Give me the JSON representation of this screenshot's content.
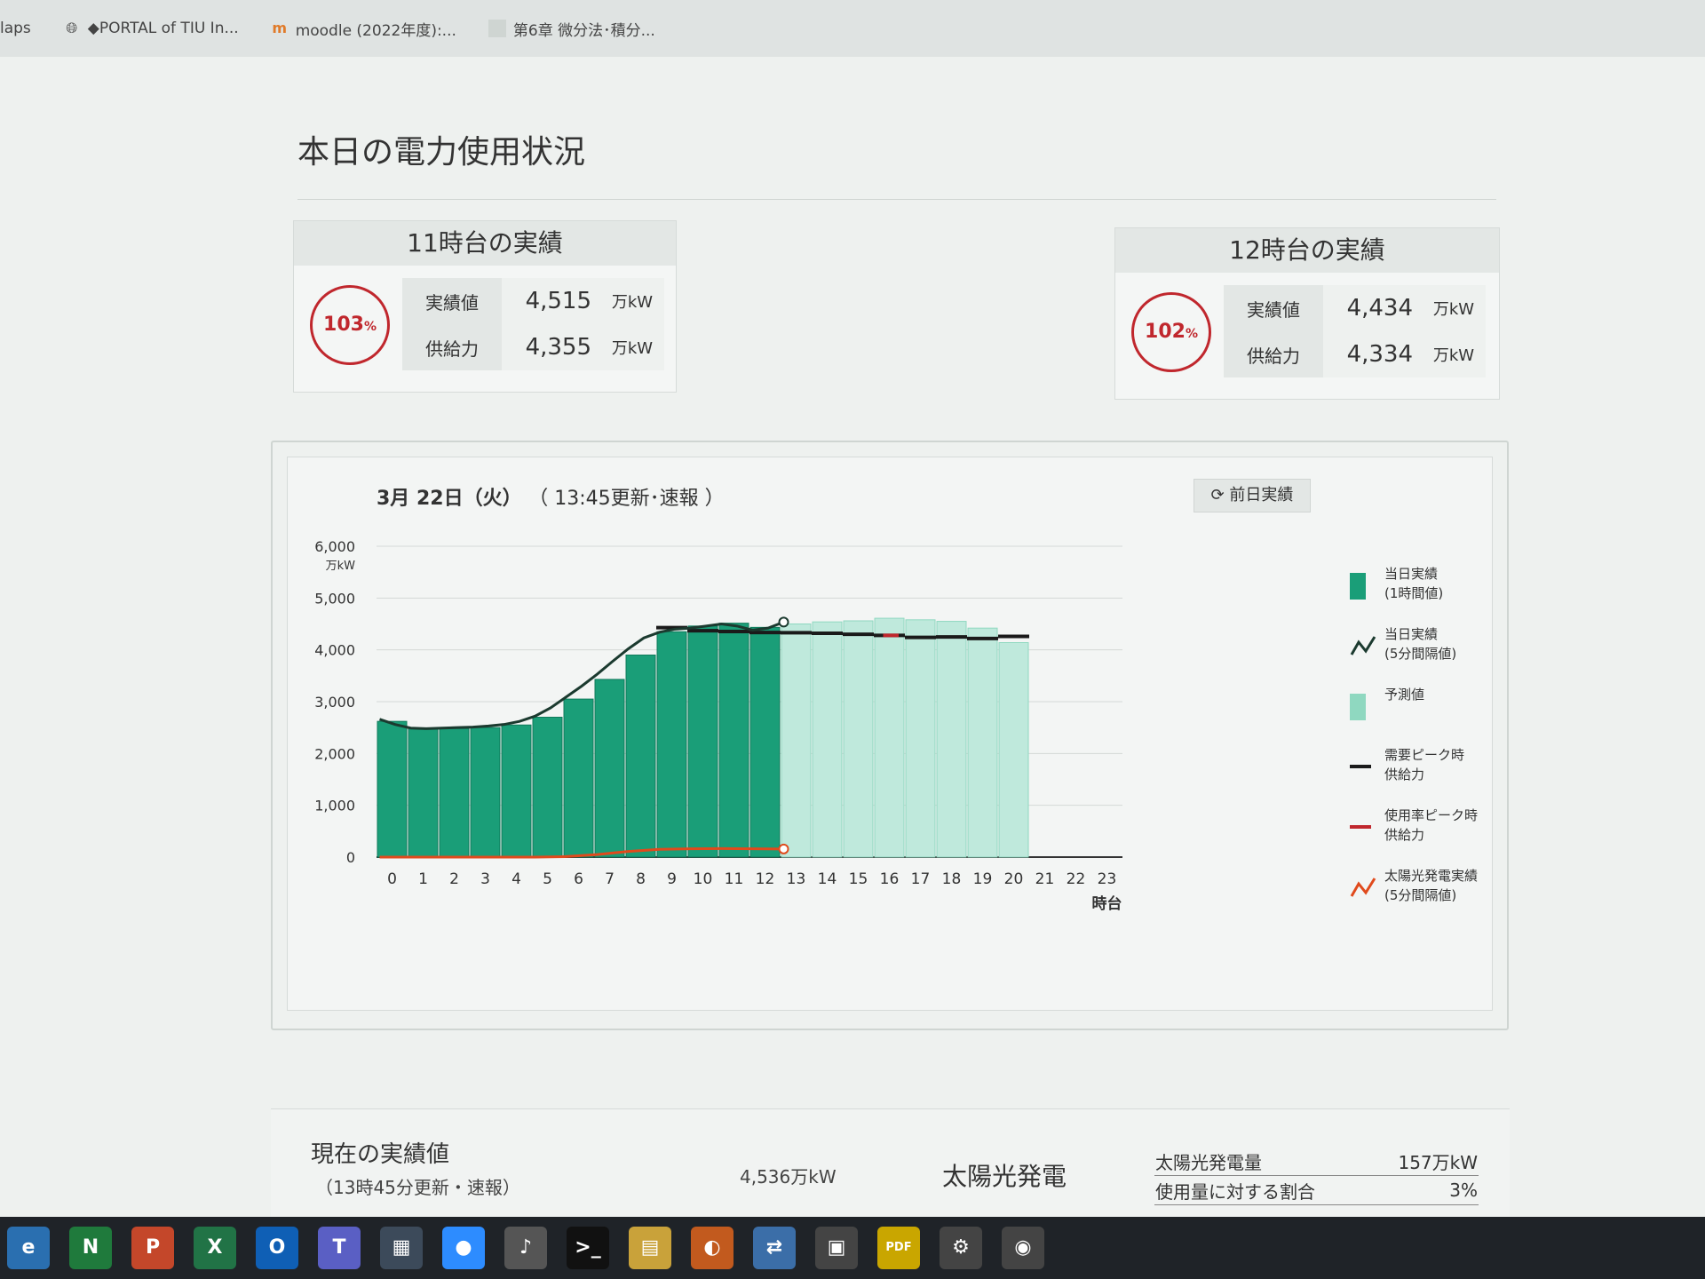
{
  "bookmarks": [
    {
      "label": "laps",
      "icon": "bookmark-icon"
    },
    {
      "label": "◆PORTAL of TIU In...",
      "icon": "globe-icon"
    },
    {
      "label": "moodle (2022年度):...",
      "icon": "moodle-icon"
    },
    {
      "label": "第6章 微分法･積分...",
      "icon": "document-icon"
    }
  ],
  "page_title": "本日の電力使用状況",
  "card11": {
    "title": "11時台の実績",
    "percent": "103",
    "percent_unit": "%",
    "actual_label": "実績値",
    "actual_value": "4,515",
    "actual_unit": "万kW",
    "supply_label": "供給力",
    "supply_value": "4,355",
    "supply_unit": "万kW"
  },
  "card12": {
    "title": "12時台の実績",
    "percent": "102",
    "percent_unit": "%",
    "actual_label": "実績値",
    "actual_value": "4,434",
    "actual_unit": "万kW",
    "supply_label": "供給力",
    "supply_value": "4,334",
    "supply_unit": "万kW"
  },
  "chart_header": {
    "date": "3月 22日（火）",
    "update": "（ 13:45更新･速報 ）",
    "prev_button": "前日実績"
  },
  "legend": [
    {
      "label1": "当日実績",
      "label2": "(1時間値)",
      "color": "#1a9e78",
      "kind": "box"
    },
    {
      "label1": "当日実績",
      "label2": "(5分間隔値)",
      "color": "#1b3a2f",
      "kind": "zigzag"
    },
    {
      "label1": "予測値",
      "label2": "",
      "color": "#8fd8c0",
      "kind": "box"
    },
    {
      "label1": "需要ピーク時",
      "label2": "供給力",
      "color": "#1a1a1a",
      "kind": "line"
    },
    {
      "label1": "使用率ピーク時",
      "label2": "供給力",
      "color": "#c0272d",
      "kind": "line"
    },
    {
      "label1": "太陽光発電実績",
      "label2": "(5分間隔値)",
      "color": "#e04a1c",
      "kind": "zigzag"
    }
  ],
  "chart_data": {
    "type": "bar",
    "y_unit": "万kW",
    "x_unit": "時台",
    "ylim": [
      0,
      6000
    ],
    "yticks": [
      "0",
      "1,000",
      "2,000",
      "3,000",
      "4,000",
      "5,000",
      "6,000"
    ],
    "categories": [
      "0",
      "1",
      "2",
      "3",
      "4",
      "5",
      "6",
      "7",
      "8",
      "9",
      "10",
      "11",
      "12",
      "13",
      "14",
      "15",
      "16",
      "17",
      "18",
      "19",
      "20",
      "21",
      "22",
      "23"
    ],
    "series": [
      {
        "name": "当日実績",
        "kind": "actual_hourly",
        "values": [
          2620,
          2490,
          2480,
          2500,
          2550,
          2700,
          3050,
          3430,
          3900,
          4350,
          4460,
          4515,
          4434,
          null,
          null,
          null,
          null,
          null,
          null,
          null,
          null,
          null,
          null,
          null
        ]
      },
      {
        "name": "予測値",
        "kind": "forecast_hourly",
        "values": [
          null,
          null,
          null,
          null,
          null,
          null,
          null,
          null,
          null,
          null,
          null,
          null,
          null,
          4500,
          4540,
          4560,
          4610,
          4580,
          4550,
          4420,
          4140,
          null,
          null,
          null
        ]
      },
      {
        "name": "需要ピーク時 供給力",
        "kind": "supply",
        "values": [
          null,
          null,
          null,
          null,
          null,
          null,
          null,
          null,
          null,
          4430,
          4370,
          4355,
          4334,
          4330,
          4320,
          4300,
          4280,
          4240,
          4250,
          4220,
          4260,
          null,
          null,
          null
        ]
      },
      {
        "name": "使用率ピーク時 供給力",
        "kind": "supply_red",
        "x": [
          16
        ],
        "values": [
          4280
        ]
      },
      {
        "name": "当日実績 (5分間隔値)",
        "kind": "actual_5min",
        "x": [
          0,
          0.5,
          1,
          1.5,
          2,
          2.5,
          3,
          3.5,
          4,
          4.5,
          5,
          5.5,
          6,
          6.5,
          7,
          7.5,
          8,
          8.5,
          9,
          9.5,
          10,
          10.5,
          11,
          11.5,
          12,
          12.5,
          13
        ],
        "values": [
          2660,
          2560,
          2490,
          2480,
          2490,
          2500,
          2510,
          2530,
          2560,
          2620,
          2720,
          2880,
          3090,
          3300,
          3530,
          3780,
          4020,
          4230,
          4340,
          4400,
          4420,
          4460,
          4500,
          4460,
          4380,
          4420,
          4536
        ]
      },
      {
        "name": "太陽光発電実績 (5分間隔値)",
        "kind": "solar_5min",
        "x": [
          0,
          5,
          6,
          7,
          8,
          9,
          10,
          11,
          12,
          13
        ],
        "values": [
          0,
          0,
          10,
          50,
          110,
          150,
          160,
          165,
          160,
          157
        ]
      }
    ]
  },
  "bottom": {
    "title": "現在の実績値",
    "subtitle": "（13時45分更新・速報）",
    "value": "4,536万kW",
    "solar_title": "太陽光発電",
    "solar_rows": [
      {
        "label": "太陽光発電量",
        "value": "157万kW"
      },
      {
        "label": "使用量に対する割合",
        "value": "3%"
      }
    ]
  },
  "taskbar": [
    {
      "icon": "browser-icon",
      "glyph": "e",
      "color": "#2a6fb0"
    },
    {
      "icon": "onenote-n-icon",
      "glyph": "N",
      "color": "#1f7a3c"
    },
    {
      "icon": "powerpoint-icon",
      "glyph": "P",
      "color": "#c4472a"
    },
    {
      "icon": "excel-icon",
      "glyph": "X",
      "color": "#217346"
    },
    {
      "icon": "outlook-icon",
      "glyph": "O",
      "color": "#0f5fb5"
    },
    {
      "icon": "teams-icon",
      "glyph": "T",
      "color": "#5a5fc4"
    },
    {
      "icon": "calculator-icon",
      "glyph": "▦",
      "color": "#3c4a5a"
    },
    {
      "icon": "zoom-icon",
      "glyph": "●",
      "color": "#2d8cff"
    },
    {
      "icon": "microphone-icon",
      "glyph": "♪",
      "color": "#555"
    },
    {
      "icon": "terminal-icon",
      "glyph": ">_",
      "color": "#111"
    },
    {
      "icon": "folder-icon",
      "glyph": "▤",
      "color": "#c9a23a"
    },
    {
      "icon": "app-icon",
      "glyph": "◐",
      "color": "#c25a1e"
    },
    {
      "icon": "network-icon",
      "glyph": "⇄",
      "color": "#3b6ea8"
    },
    {
      "icon": "window-icon",
      "glyph": "▣",
      "color": "#444"
    },
    {
      "icon": "pdf-icon",
      "glyph": "PDF",
      "color": "#c9a600"
    },
    {
      "icon": "gear-icon",
      "glyph": "⚙",
      "color": "#444"
    },
    {
      "icon": "camera-icon",
      "glyph": "◉",
      "color": "#444"
    }
  ]
}
